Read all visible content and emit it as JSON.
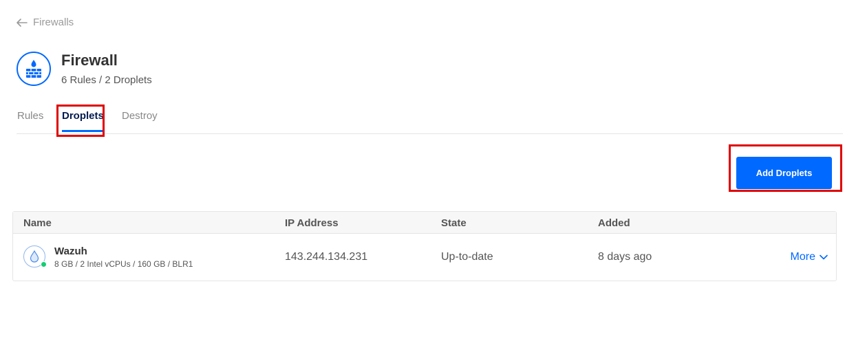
{
  "breadcrumb": {
    "label": "Firewalls"
  },
  "header": {
    "title": "Firewall",
    "subtitle": "6 Rules / 2 Droplets"
  },
  "tabs": [
    {
      "label": "Rules",
      "active": false
    },
    {
      "label": "Droplets",
      "active": true
    },
    {
      "label": "Destroy",
      "active": false
    }
  ],
  "actions": {
    "add_droplets_label": "Add Droplets"
  },
  "table": {
    "columns": [
      "Name",
      "IP Address",
      "State",
      "Added"
    ],
    "rows": [
      {
        "name": "Wazuh",
        "spec": "8 GB / 2 Intel vCPUs / 160 GB / BLR1",
        "ip": "143.244.134.231",
        "state": "Up-to-date",
        "added": "8 days ago",
        "more_label": "More",
        "status": "active"
      }
    ]
  },
  "colors": {
    "accent": "#0069ff",
    "highlight": "#e00000",
    "status_active": "#15cd72"
  },
  "icons": [
    "arrow-left-icon",
    "firewall-icon",
    "droplet-icon",
    "chevron-down-icon"
  ]
}
